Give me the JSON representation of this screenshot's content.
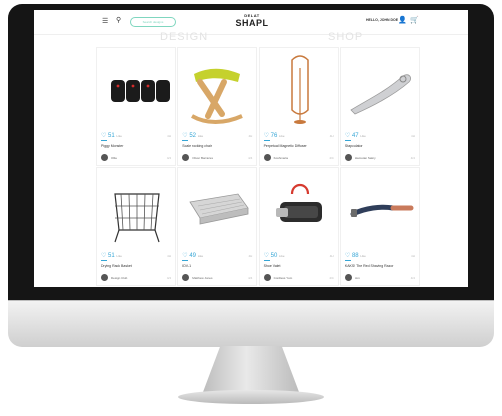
{
  "header": {
    "logo_small": "DELAT",
    "logo_big": "SHAPL",
    "search_placeholder": "Search designs",
    "user_link": "HELLO, JOHN DOE"
  },
  "tabs": [
    {
      "label": "DESIGN"
    },
    {
      "label": "SHOP"
    }
  ],
  "cards": [
    {
      "likes": "51",
      "title": "Piggy Monster",
      "author": "Ollie"
    },
    {
      "likes": "52",
      "title": "Scale rocking chair",
      "author": "Oliver Barrazes"
    },
    {
      "likes": "76",
      "title": "Perpetual Magnetic Diffuser",
      "author": "Koshmaria"
    },
    {
      "likes": "47",
      "title": "Stapculator",
      "author": "Hamutan Sakry"
    },
    {
      "likes": "51",
      "title": "Drying Rack Basket",
      "author": "Design Club"
    },
    {
      "likes": "49",
      "title": "IDV-1",
      "author": "Matthew Jones"
    },
    {
      "likes": "50",
      "title": "Shoe Valet",
      "author": "Cordless Yum"
    },
    {
      "likes": "88",
      "title": "KAKS! The Red Shaving Razor",
      "author": "Jon"
    }
  ]
}
